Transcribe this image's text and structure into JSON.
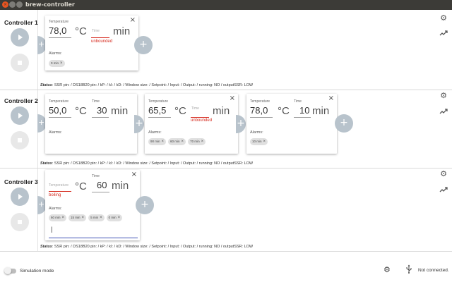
{
  "window": {
    "title": "brew-controller"
  },
  "labels": {
    "temperature": "Temperature",
    "time": "Time",
    "alarms": "Alarms:",
    "celsius": "°C",
    "min": "min",
    "status_prefix": "Status",
    "chip_remove": "×",
    "close": "×",
    "add": "+"
  },
  "status_text": ": SSR pin: / DS18B20 pin: / kP: / kI: / kD: / Window size: / Setpoint: / Input: / Output: / running: NO / outputSSR: LOW",
  "controllers": [
    {
      "name": "Controller 1",
      "cards": [
        {
          "temperature": "78,0",
          "time": "",
          "note": "unbounded",
          "alarms": [
            "0 min"
          ]
        }
      ]
    },
    {
      "name": "Controller 2",
      "cards": [
        {
          "temperature": "50,0",
          "time": "30",
          "note": "",
          "alarms": []
        },
        {
          "temperature": "65,5",
          "time": "",
          "note": "unbounded",
          "alarms": [
            "90 min",
            "60 min",
            "70 min"
          ]
        },
        {
          "temperature": "78,0",
          "time": "10",
          "note": "",
          "alarms": [
            "10 min"
          ]
        }
      ]
    },
    {
      "name": "Controller 3",
      "cards": [
        {
          "temperature": "",
          "time": "60",
          "note": "boiling",
          "alarms": [
            "60 min",
            "15 min",
            "5 min",
            "0 min"
          ],
          "alarm_input": "|"
        }
      ]
    }
  ],
  "footer": {
    "simulation_label": "Simulation mode",
    "connection": "Not connected."
  },
  "icons": {
    "settings": "gear-icon",
    "chart": "trending-up-icon",
    "usb": "usb-icon",
    "play": "play-icon",
    "stop": "stop-icon"
  }
}
